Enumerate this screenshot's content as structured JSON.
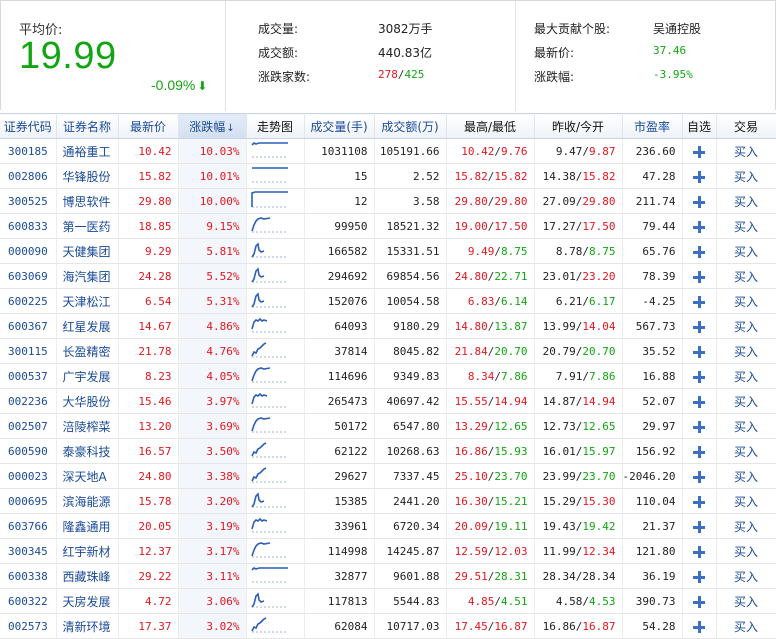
{
  "summary": {
    "avg_price_label": "平均价:",
    "avg_price": "19.99",
    "avg_change": "-0.09%",
    "volume_label": "成交量:",
    "volume_value": "3082万手",
    "amount_label": "成交额:",
    "amount_value": "440.83亿",
    "updown_label": "涨跌家数:",
    "up_count": "278",
    "down_count": "425",
    "top_contrib_label": "最大贡献个股:",
    "top_contrib_value": "吴通控股",
    "latest_price_label": "最新价:",
    "latest_price_value": "37.46",
    "change_pct_label": "涨跌幅:",
    "change_pct_value": "-3.95%"
  },
  "colors": {
    "up": "#e3161d",
    "down": "#11a611",
    "link": "#1a4a99"
  },
  "table": {
    "headers": {
      "code": "证券代码",
      "name": "证券名称",
      "price": "最新价",
      "chg": "涨跌幅",
      "trend": "走势图",
      "vol": "成交量(手)",
      "amt": "成交额(万)",
      "hl": "最高/最低",
      "pc": "昨收/今开",
      "pe": "市盈率",
      "fav": "自选",
      "trade": "交易"
    },
    "sort_icon": "arrow-down-icon",
    "buy_label": "买入",
    "rows": [
      {
        "code": "300185",
        "name": "通裕重工",
        "price": "10.42",
        "chg": "10.03%",
        "vol": "1031108",
        "amt": "105191.66",
        "high": "10.42",
        "low": "9.76",
        "prev": "9.47",
        "open": "9.87",
        "pe": "236.60",
        "open_up": true,
        "spark": "flat-high"
      },
      {
        "code": "002806",
        "name": "华锋股份",
        "price": "15.82",
        "chg": "10.01%",
        "vol": "15",
        "amt": "2.52",
        "high": "15.82",
        "low": "15.82",
        "prev": "14.38",
        "open": "15.82",
        "pe": "47.28",
        "open_up": true,
        "spark": "flat"
      },
      {
        "code": "300525",
        "name": "博思软件",
        "price": "29.80",
        "chg": "10.00%",
        "vol": "12",
        "amt": "3.58",
        "high": "29.80",
        "low": "29.80",
        "prev": "27.09",
        "open": "29.80",
        "pe": "211.74",
        "open_up": true,
        "spark": "step"
      },
      {
        "code": "600833",
        "name": "第一医药",
        "price": "18.85",
        "chg": "9.15%",
        "vol": "99950",
        "amt": "18521.32",
        "high": "19.00",
        "low": "17.50",
        "prev": "17.27",
        "open": "17.50",
        "pe": "79.44",
        "open_up": true,
        "spark": "rise"
      },
      {
        "code": "000090",
        "name": "天健集团",
        "price": "9.29",
        "chg": "5.81%",
        "vol": "166582",
        "amt": "15331.51",
        "high": "9.49",
        "low": "8.75",
        "prev": "8.78",
        "open": "8.75",
        "pe": "65.76",
        "open_up": false,
        "spark": "spike"
      },
      {
        "code": "603069",
        "name": "海汽集团",
        "price": "24.28",
        "chg": "5.52%",
        "vol": "294692",
        "amt": "69854.56",
        "high": "24.80",
        "low": "22.71",
        "prev": "23.01",
        "open": "23.20",
        "pe": "78.39",
        "open_up": true,
        "spark": "spike"
      },
      {
        "code": "600225",
        "name": "天津松江",
        "price": "6.54",
        "chg": "5.31%",
        "vol": "152076",
        "amt": "10054.58",
        "high": "6.83",
        "low": "6.14",
        "prev": "6.21",
        "open": "6.17",
        "pe": "-4.25",
        "open_up": false,
        "spark": "spike"
      },
      {
        "code": "600367",
        "name": "红星发展",
        "price": "14.67",
        "chg": "4.86%",
        "vol": "64093",
        "amt": "9180.29",
        "high": "14.80",
        "low": "13.87",
        "prev": "13.99",
        "open": "14.04",
        "pe": "567.73",
        "open_up": true,
        "spark": "wave"
      },
      {
        "code": "300115",
        "name": "长盈精密",
        "price": "21.78",
        "chg": "4.76%",
        "vol": "37814",
        "amt": "8045.82",
        "high": "21.84",
        "low": "20.70",
        "prev": "20.79",
        "open": "20.70",
        "pe": "35.52",
        "open_up": false,
        "spark": "climb"
      },
      {
        "code": "000537",
        "name": "广宇发展",
        "price": "8.23",
        "chg": "4.05%",
        "vol": "114696",
        "amt": "9349.83",
        "high": "8.34",
        "low": "7.86",
        "prev": "7.91",
        "open": "7.86",
        "pe": "16.88",
        "open_up": false,
        "spark": "rise"
      },
      {
        "code": "002236",
        "name": "大华股份",
        "price": "15.46",
        "chg": "3.97%",
        "vol": "265473",
        "amt": "40697.42",
        "high": "15.55",
        "low": "14.94",
        "prev": "14.87",
        "open": "14.94",
        "pe": "52.07",
        "open_up": true,
        "spark": "wave"
      },
      {
        "code": "002507",
        "name": "涪陵榨菜",
        "price": "13.20",
        "chg": "3.69%",
        "vol": "50172",
        "amt": "6547.80",
        "high": "13.29",
        "low": "12.65",
        "prev": "12.73",
        "open": "12.65",
        "pe": "29.97",
        "open_up": false,
        "spark": "rise"
      },
      {
        "code": "600590",
        "name": "泰豪科技",
        "price": "16.57",
        "chg": "3.50%",
        "vol": "62122",
        "amt": "10268.63",
        "high": "16.86",
        "low": "15.93",
        "prev": "16.01",
        "open": "15.97",
        "pe": "156.92",
        "open_up": false,
        "spark": "climb"
      },
      {
        "code": "000023",
        "name": "深天地A",
        "price": "24.80",
        "chg": "3.38%",
        "vol": "29627",
        "amt": "7337.45",
        "high": "25.10",
        "low": "23.70",
        "prev": "23.99",
        "open": "23.70",
        "pe": "-2046.20",
        "open_up": false,
        "spark": "climb"
      },
      {
        "code": "000695",
        "name": "滨海能源",
        "price": "15.78",
        "chg": "3.20%",
        "vol": "15385",
        "amt": "2441.20",
        "high": "16.30",
        "low": "15.21",
        "prev": "15.29",
        "open": "15.30",
        "pe": "110.04",
        "open_up": true,
        "spark": "spike"
      },
      {
        "code": "603766",
        "name": "隆鑫通用",
        "price": "20.05",
        "chg": "3.19%",
        "vol": "33961",
        "amt": "6720.34",
        "high": "20.09",
        "low": "19.11",
        "prev": "19.43",
        "open": "19.42",
        "pe": "21.37",
        "open_up": false,
        "spark": "wave"
      },
      {
        "code": "300345",
        "name": "红宇新材",
        "price": "12.37",
        "chg": "3.17%",
        "vol": "114998",
        "amt": "14245.87",
        "high": "12.59",
        "low": "12.03",
        "prev": "11.99",
        "open": "12.34",
        "pe": "121.80",
        "open_up": true,
        "spark": "rise"
      },
      {
        "code": "600338",
        "name": "西藏珠峰",
        "price": "29.22",
        "chg": "3.11%",
        "vol": "32877",
        "amt": "9601.88",
        "high": "29.51",
        "low": "28.31",
        "prev": "28.34",
        "open": "28.34",
        "pe": "36.19",
        "open_up": null,
        "spark": "flat-high"
      },
      {
        "code": "600322",
        "name": "天房发展",
        "price": "4.72",
        "chg": "3.06%",
        "vol": "117813",
        "amt": "5544.83",
        "high": "4.85",
        "low": "4.51",
        "prev": "4.58",
        "open": "4.53",
        "pe": "390.73",
        "open_up": false,
        "spark": "spike"
      },
      {
        "code": "002573",
        "name": "清新环境",
        "price": "17.37",
        "chg": "3.02%",
        "vol": "62084",
        "amt": "10717.03",
        "high": "17.45",
        "low": "16.87",
        "prev": "16.86",
        "open": "16.87",
        "pe": "54.28",
        "open_up": true,
        "spark": "climb"
      }
    ]
  }
}
